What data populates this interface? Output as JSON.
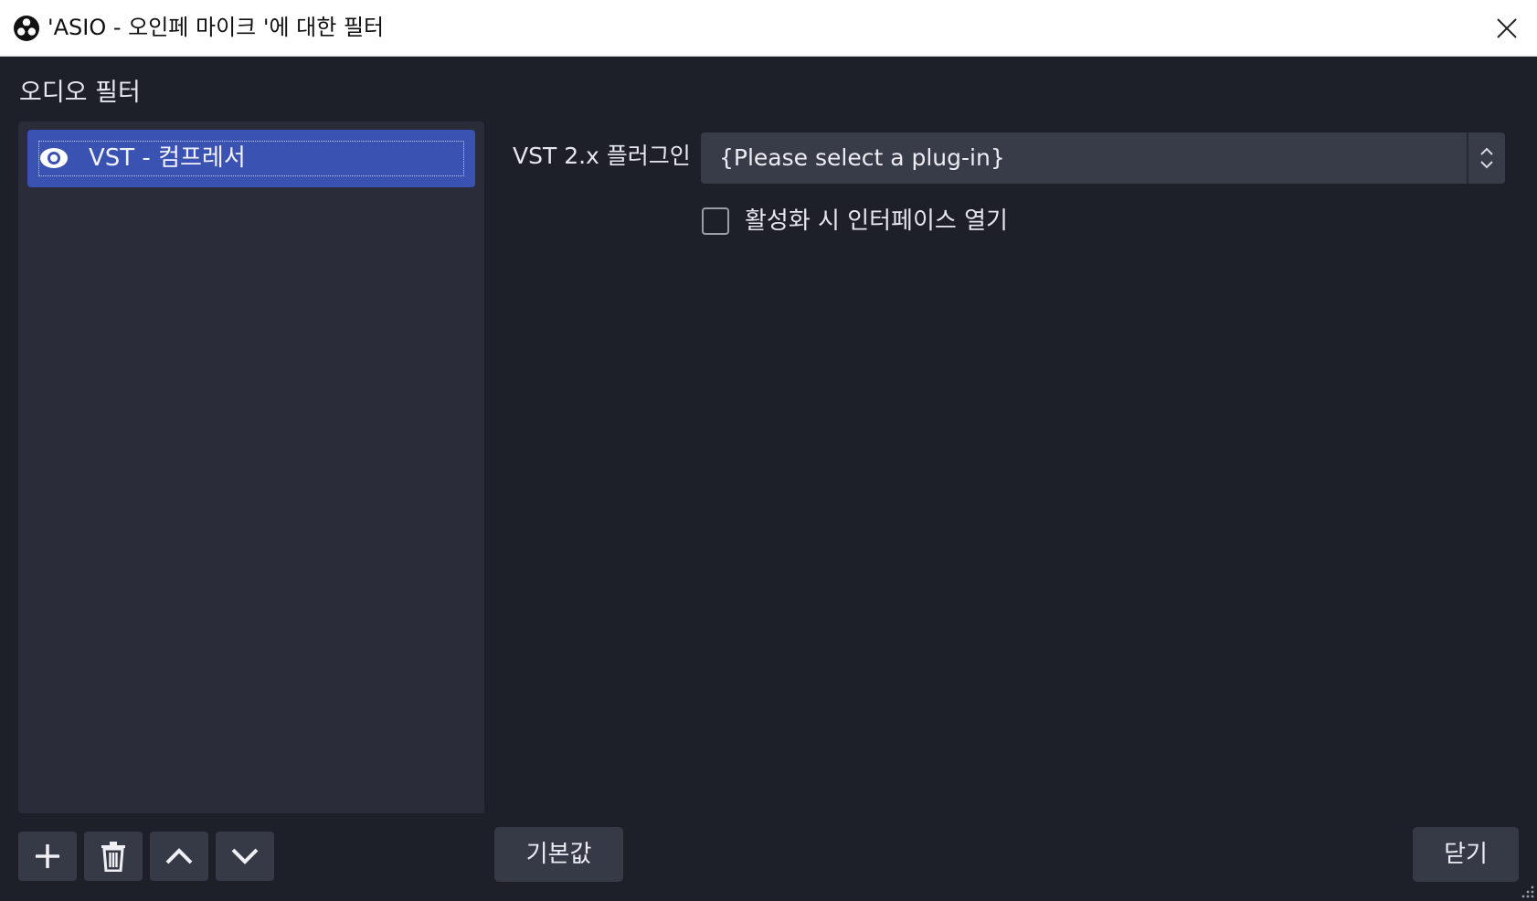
{
  "window": {
    "title": "'ASIO - 오인페 마이크 '에 대한 필터",
    "app_icon": "obs-logo-icon",
    "close_icon": "close-icon"
  },
  "filters_panel": {
    "label": "오디오 필터",
    "items": [
      {
        "name": "VST - 컴프레서",
        "visibility_icon": "eye-icon",
        "selected": true
      }
    ],
    "toolbar": [
      {
        "icon": "plus-icon"
      },
      {
        "icon": "trash-icon"
      },
      {
        "icon": "chevron-up-icon"
      },
      {
        "icon": "chevron-down-icon"
      }
    ]
  },
  "properties": {
    "plugin_label": "VST 2.x 플러그인",
    "plugin_select_value": "{Please select a plug-in}",
    "open_interface_checkbox": {
      "label": "활성화 시 인터페이스 열기",
      "checked": false
    }
  },
  "buttons": {
    "defaults_label": "기본값",
    "close_label": "닫기"
  },
  "colors": {
    "background": "#1e2029",
    "panel": "#2a2d39",
    "selected_item": "#3a52b2",
    "button": "#363a47"
  }
}
